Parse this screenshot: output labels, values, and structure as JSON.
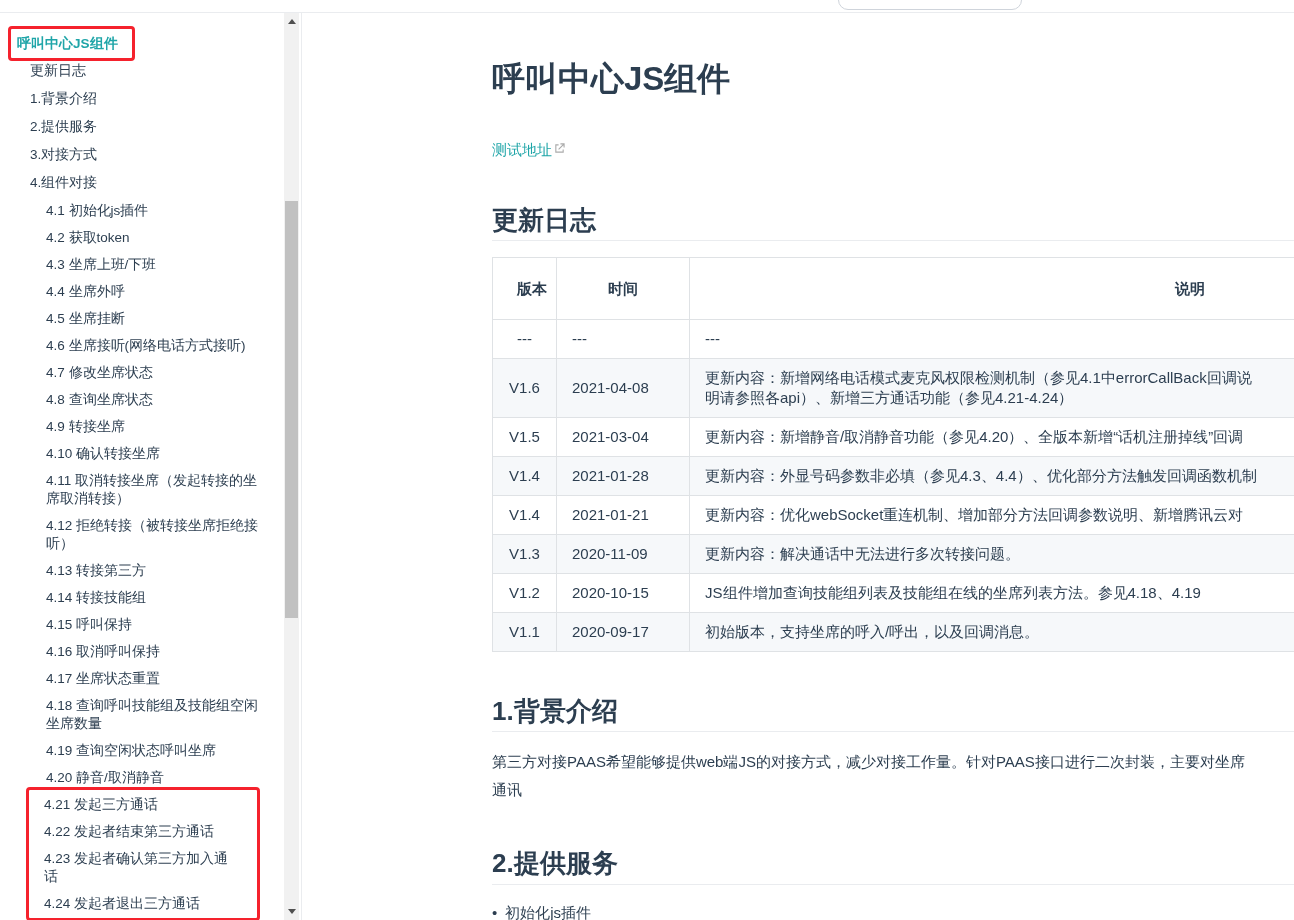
{
  "sidebar": {
    "items": [
      {
        "label": "呼叫中心JS组件",
        "selected": true,
        "boxed": true,
        "children": [
          {
            "label": "更新日志",
            "selected": false,
            "boxed": false
          },
          {
            "label": "1.背景介绍",
            "selected": false,
            "boxed": false
          },
          {
            "label": "2.提供服务",
            "selected": false,
            "boxed": false
          },
          {
            "label": "3.对接方式",
            "selected": false,
            "boxed": false
          },
          {
            "label": "4.组件对接",
            "selected": false,
            "boxed": false,
            "children": [
              {
                "label": "4.1 初始化js插件",
                "selected": false,
                "boxed": false
              },
              {
                "label": "4.2 获取token",
                "selected": false,
                "boxed": false
              },
              {
                "label": "4.3 坐席上班/下班",
                "selected": false,
                "boxed": false
              },
              {
                "label": "4.4 坐席外呼",
                "selected": false,
                "boxed": false
              },
              {
                "label": "4.5 坐席挂断",
                "selected": false,
                "boxed": false
              },
              {
                "label": "4.6 坐席接听(网络电话方式接听)",
                "selected": false,
                "boxed": false
              },
              {
                "label": "4.7 修改坐席状态",
                "selected": false,
                "boxed": false
              },
              {
                "label": "4.8 查询坐席状态",
                "selected": false,
                "boxed": false
              },
              {
                "label": "4.9 转接坐席",
                "selected": false,
                "boxed": false
              },
              {
                "label": "4.10 确认转接坐席",
                "selected": false,
                "boxed": false
              },
              {
                "label": "4.11 取消转接坐席（发起转接的坐席取消转接）",
                "selected": false,
                "boxed": false
              },
              {
                "label": "4.12 拒绝转接（被转接坐席拒绝接听）",
                "selected": false,
                "boxed": false
              },
              {
                "label": "4.13 转接第三方",
                "selected": false,
                "boxed": false
              },
              {
                "label": "4.14 转接技能组",
                "selected": false,
                "boxed": false
              },
              {
                "label": "4.15 呼叫保持",
                "selected": false,
                "boxed": false
              },
              {
                "label": "4.16 取消呼叫保持",
                "selected": false,
                "boxed": false
              },
              {
                "label": "4.17 坐席状态重置",
                "selected": false,
                "boxed": false
              },
              {
                "label": "4.18 查询呼叫技能组及技能组空闲坐席数量",
                "selected": false,
                "boxed": false
              },
              {
                "label": "4.19 查询空闲状态呼叫坐席",
                "selected": false,
                "boxed": false
              },
              {
                "label": "4.20 静音/取消静音",
                "selected": false,
                "boxed": false
              },
              {
                "label": "4.21 发起三方通话",
                "selected": false,
                "boxed": true
              },
              {
                "label": "4.22 发起者结束第三方通话",
                "selected": false,
                "boxed": true
              },
              {
                "label": "4.23 发起者确认第三方加入通话",
                "selected": false,
                "boxed": true
              },
              {
                "label": "4.24 发起者退出三方通话",
                "selected": false,
                "boxed": true
              }
            ]
          }
        ]
      }
    ]
  },
  "content": {
    "title": "呼叫中心JS组件",
    "link": "测试地址",
    "sections": [
      {
        "kind": "table",
        "heading": "更新日志",
        "table": {
          "columns": [
            "版本",
            "时间",
            "说明"
          ],
          "rows": [
            {
              "version": "---",
              "date": "---",
              "lines": [
                "---"
              ]
            },
            {
              "version": "V1.6",
              "date": "2021-04-08",
              "lines": [
                "更新内容：新增网络电话模式麦克风权限检测机制（参见4.1中errorCallBack回调说",
                "明请参照各api）、新增三方通话功能（参见4.21-4.24）"
              ]
            },
            {
              "version": "V1.5",
              "date": "2021-03-04",
              "lines": [
                "更新内容：新增静音/取消静音功能（参见4.20）、全版本新增“话机注册掉线”回调"
              ]
            },
            {
              "version": "V1.4",
              "date": "2021-01-28",
              "lines": [
                "更新内容：外显号码参数非必填（参见4.3、4.4）、优化部分方法触发回调函数机制"
              ]
            },
            {
              "version": "V1.4",
              "date": "2021-01-21",
              "lines": [
                "更新内容：优化webSocket重连机制、增加部分方法回调参数说明、新增腾讯云对"
              ]
            },
            {
              "version": "V1.3",
              "date": "2020-11-09",
              "lines": [
                "更新内容：解决通话中无法进行多次转接问题。"
              ]
            },
            {
              "version": "V1.2",
              "date": "2020-10-15",
              "lines": [
                "JS组件增加查询技能组列表及技能组在线的坐席列表方法。参见4.18、4.19"
              ]
            },
            {
              "version": "V1.1",
              "date": "2020-09-17",
              "lines": [
                "初始版本，支持坐席的呼入/呼出，以及回调消息。"
              ]
            }
          ]
        }
      },
      {
        "kind": "paragraph",
        "heading": "1.背景介绍",
        "lines": [
          "第三方对接PAAS希望能够提供web端JS的对接方式，减少对接工作量。针对PAAS接口进行二次封装，主要对坐席",
          "通讯"
        ]
      },
      {
        "kind": "list",
        "heading": "2.提供服务",
        "bullet": "•",
        "items": [
          "初始化js插件"
        ]
      }
    ]
  }
}
